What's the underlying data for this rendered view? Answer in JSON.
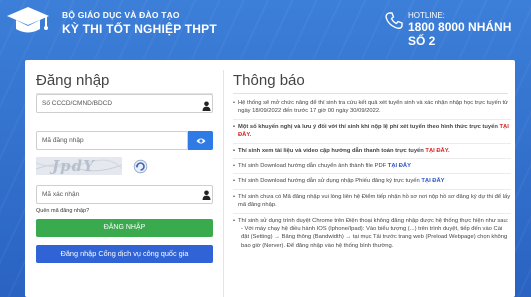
{
  "header": {
    "org": "BỘ GIÁO DỤC VÀ ĐÀO TẠO",
    "exam": "KỲ THI TỐT NGHIỆP THPT",
    "hotline_label": "HOTLINE:",
    "hotline_number": "1800 8000 NHÁNH SỐ 2",
    "logo_icon": "graduation-cap-icon",
    "phone_icon": "phone-icon"
  },
  "login": {
    "title": "Đăng nhập",
    "id_placeholder": "Số CCCD/CMND/BDCD",
    "password_placeholder": "Mã đăng nhập",
    "captcha_text": "JpdY",
    "captcha_placeholder": "Mã xác nhận",
    "forgot": "Quên mã đăng nhập?",
    "login_button": "ĐĂNG NHẬP",
    "portal_button": "Đăng nhập Cổng dịch vụ công quốc gia"
  },
  "news": {
    "title": "Thông báo",
    "items": [
      {
        "text": "Hệ thống sẽ mở chức năng để thí sinh tra cứu kết quả xét tuyển sinh và xác nhận nhập học trực tuyến từ ngày 18/09/2022 đến trước 17 giờ 00 ngày 30/09/2022."
      },
      {
        "text": "Một số khuyến nghị và lưu ý đối với thí sinh khi nộp lệ phí xét tuyển theo hình thức trực tuyến ",
        "link": "TẠI ĐÂY."
      },
      {
        "text": "Thí sinh xem tài liệu và video cập hướng dẫn thanh toán trực tuyến ",
        "link": "TẠI ĐÂY."
      },
      {
        "text": "Thí sinh Download hướng dẫn chuyển ảnh thành file PDF ",
        "link": "TẠI ĐÂY"
      },
      {
        "text": "Thí sinh Download hướng dẫn sử dụng nhập Phiếu đăng ký trực tuyến ",
        "link": "TẠI ĐÂY"
      },
      {
        "text": "Thí sinh chưa có Mã đăng nhập vui lòng liên hệ Điểm tiếp nhận hồ sơ nơi nộp hồ sơ đăng ký dự thi để lấy mã đăng nhập."
      },
      {
        "text": "Thí sinh sử dụng trình duyệt Chrome trên Điện thoại không đăng nhập được hệ thống thực hiện như sau:",
        "sub": "- Với máy chạy hệ điều hành IOS (Iphone/Ipad): Vào biểu tượng (...) trên trình duyệt, tiếp đến vào Cài đặt (Setting) → Băng thông (Bandwidth) → tại mục Tải trước trang web (Preload Webpage) chọn không bao giờ (Nerver). Để đăng nhập vào hệ thống bình thường."
      }
    ]
  },
  "colors": {
    "background": "#2f6fcf",
    "login_button": "#3aaa4f",
    "portal_button": "#2f63d6",
    "link_red": "#d62222",
    "link_blue": "#2b56c8"
  }
}
